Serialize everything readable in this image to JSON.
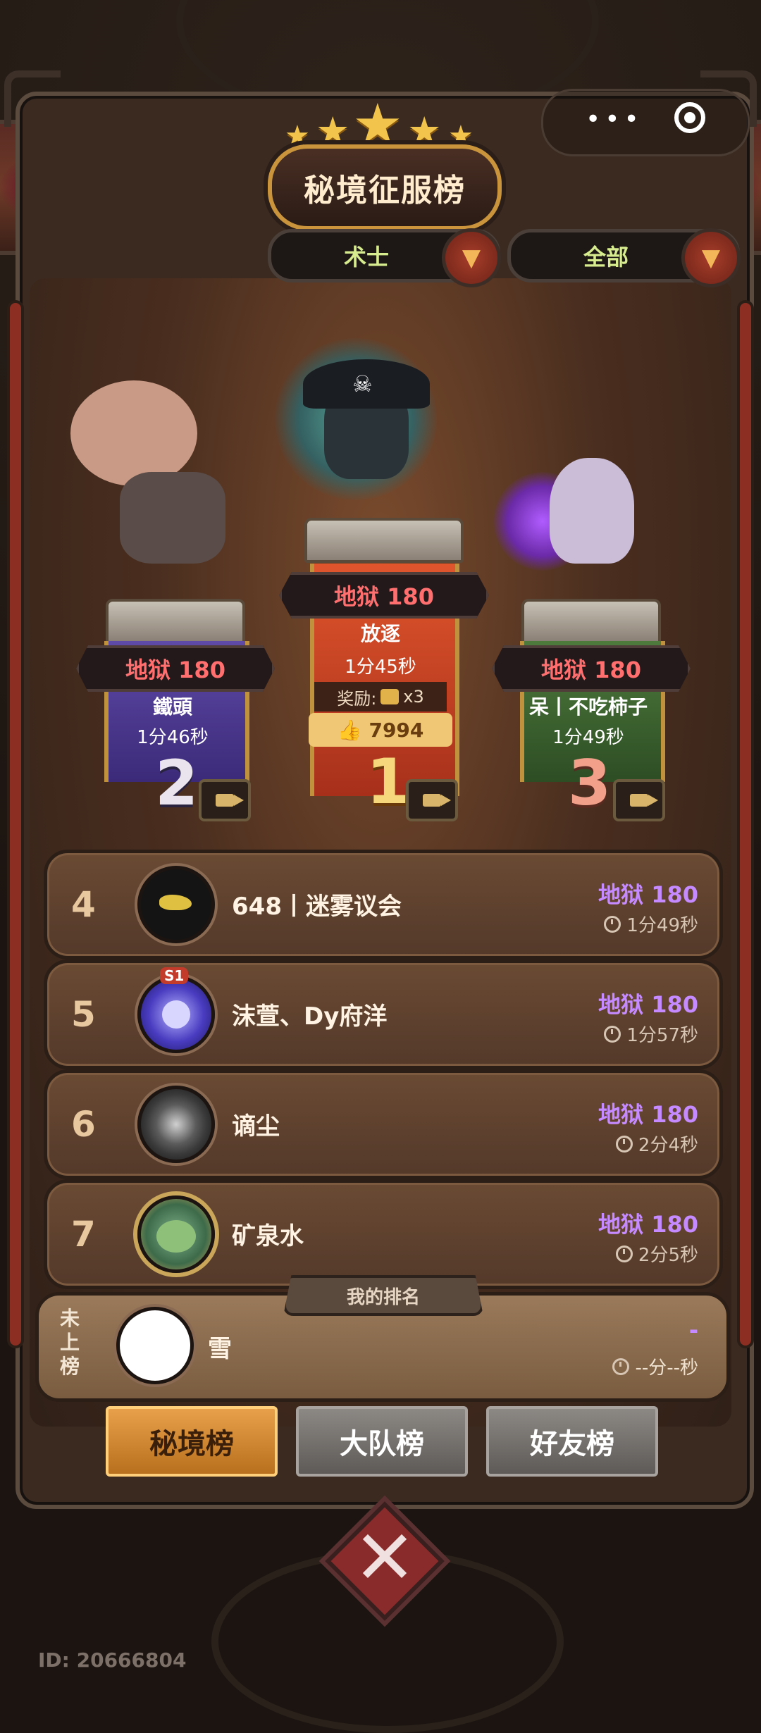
{
  "window": {
    "capsule_dots": "•••"
  },
  "header": {
    "title": "秘境征服榜"
  },
  "filters": {
    "class_filter": "术士",
    "scope_filter": "全部",
    "arrow": "▼"
  },
  "podium": {
    "first": {
      "rank": "1",
      "level": "地狱 180",
      "name": "放逐",
      "time": "1分45秒",
      "reward_label": "奖励:",
      "reward_count": "x3",
      "likes": "7994"
    },
    "second": {
      "rank": "2",
      "level": "地狱 180",
      "name": "鐵頭",
      "time": "1分46秒"
    },
    "third": {
      "rank": "3",
      "level": "地狱 180",
      "name": "呆丨不吃柿子",
      "time": "1分49秒"
    }
  },
  "rows": [
    {
      "rank": "4",
      "name": "648丨迷雾议会",
      "level": "地狱 180",
      "time": "1分49秒"
    },
    {
      "rank": "5",
      "name": "沫萱、Dy府洋",
      "level": "地狱 180",
      "time": "1分57秒",
      "badge": "S1"
    },
    {
      "rank": "6",
      "name": "谪尘",
      "level": "地狱 180",
      "time": "2分4秒"
    },
    {
      "rank": "7",
      "name": "矿泉水",
      "level": "地狱 180",
      "time": "2分5秒"
    }
  ],
  "my_rank": {
    "label": "我的排名",
    "status": "未上榜",
    "name": "雪",
    "level": "-",
    "time": "--分--秒"
  },
  "tabs": {
    "secret_realm": "秘境榜",
    "squad": "大队榜",
    "friends": "好友榜"
  },
  "footer": {
    "user_id": "ID: 20666804"
  },
  "colors": {
    "level_purple": "#c58aff",
    "level_red": "#ff6f6f",
    "accent_gold": "#e8a04a"
  }
}
